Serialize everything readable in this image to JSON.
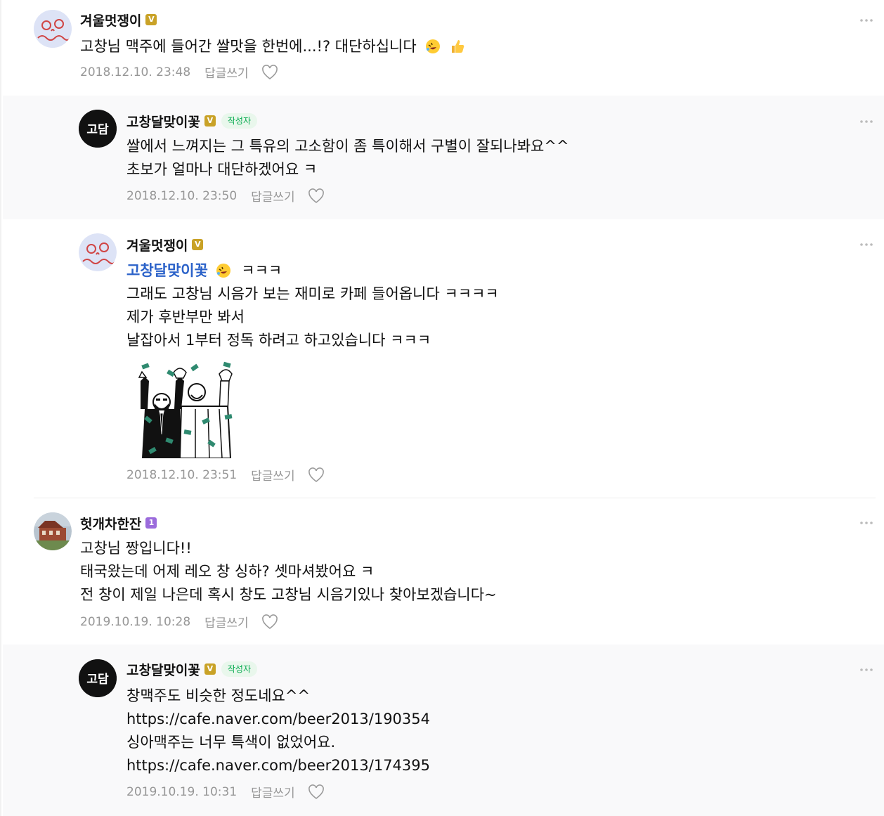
{
  "comments": [
    {
      "nickname": "겨울멋쟁이",
      "badge": "V",
      "lines": [
        "고창님 맥주에 들어간 쌀맛을 한번에...!? 대단하십니다"
      ],
      "emojis": [
        "rolling-laughing-emoji",
        "thumbs-up-emoji"
      ],
      "date": "2018.12.10. 23:48",
      "reply_label": "답글쓰기"
    },
    {
      "nickname": "고창달맞이꽃",
      "badge": "V",
      "author_badge": "작성자",
      "lines": [
        "쌀에서 느껴지는 그 특유의 고소함이 좀 특이해서 구별이 잘되나봐요^^",
        "초보가 얼마나 대단하겠어요 ㅋ"
      ],
      "date": "2018.12.10. 23:50",
      "reply_label": "답글쓰기"
    },
    {
      "nickname": "겨울멋쟁이",
      "badge": "V",
      "mention": "고창달맞이꽃",
      "mention_suffix": "ㅋㅋㅋ",
      "lines": [
        "그래도 고창님 시음가 보는 재미로 카페 들어옵니다 ㅋㅋㅋㅋ",
        "제가 후반부만 봐서",
        "날잡아서 1부터 정독 하려고 하고있습니다 ㅋㅋㅋ"
      ],
      "sticker": "money-rain-sticker",
      "date": "2018.12.10. 23:51",
      "reply_label": "답글쓰기"
    },
    {
      "nickname": "헛개차한잔",
      "badge": "1",
      "lines": [
        "고창님 짱입니다!!",
        "태국왔는데 어제 레오 창 싱하? 셋마셔봤어요 ㅋ",
        "전 창이 제일 나은데 혹시 창도 고창님 시음기있나 찾아보겠습니다~"
      ],
      "date": "2019.10.19. 10:28",
      "reply_label": "답글쓰기"
    },
    {
      "nickname": "고창달맞이꽃",
      "badge": "V",
      "author_badge": "작성자",
      "lines": [
        "창맥주도 비슷한 정도네요^^",
        "https://cafe.naver.com/beer2013/190354",
        "싱아맥주는 너무 특색이 없었어요.",
        "https://cafe.naver.com/beer2013/174395"
      ],
      "date": "2019.10.19. 10:31",
      "reply_label": "답글쓰기"
    }
  ],
  "avatar_text": "고담",
  "colors": {
    "mention": "#2b62c9",
    "author_badge_text": "#03a94d",
    "author_badge_bg": "#e9f7ec",
    "meta": "#979797",
    "reply_bg": "#f9f9fa",
    "badge_v": "#c9a227",
    "badge_1": "#9b6bdc"
  }
}
